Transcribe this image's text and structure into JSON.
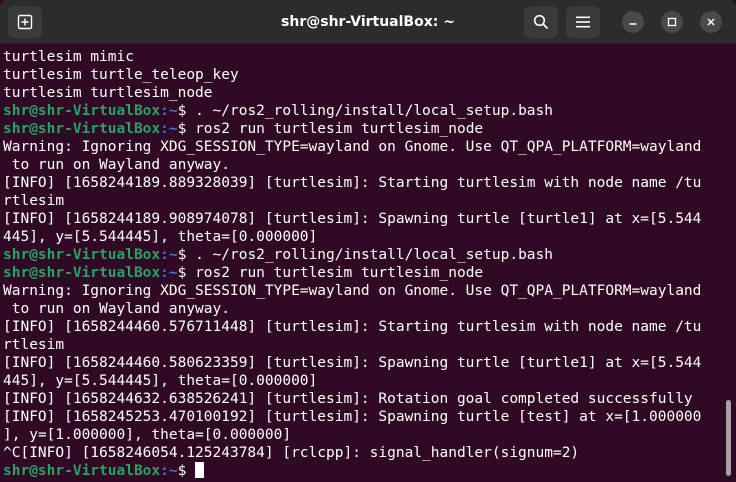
{
  "window": {
    "title": "shr@shr-VirtualBox: ~",
    "colors": {
      "background": "#300a24",
      "titlebar": "#2c2c2c",
      "prompt_user": "#26a269",
      "prompt_path": "#3b78d0",
      "text": "#ffffff"
    }
  },
  "icons": {
    "new_tab": "new-tab-icon",
    "search": "search-icon",
    "menu": "hamburger-menu-icon",
    "minimize": "minimize-icon",
    "maximize": "maximize-icon",
    "close": "close-icon"
  },
  "prompt": {
    "user_host": "shr@shr-VirtualBox",
    "path": ":~",
    "symbol": "$ "
  },
  "lines": [
    {
      "type": "text",
      "text": "turtlesim mimic"
    },
    {
      "type": "text",
      "text": "turtlesim turtle_teleop_key"
    },
    {
      "type": "text",
      "text": "turtlesim turtlesim_node"
    },
    {
      "type": "prompt",
      "cmd": ". ~/ros2_rolling/install/local_setup.bash"
    },
    {
      "type": "prompt",
      "cmd": "ros2 run turtlesim turtlesim_node"
    },
    {
      "type": "text",
      "text": "Warning: Ignoring XDG_SESSION_TYPE=wayland on Gnome. Use QT_QPA_PLATFORM=wayland"
    },
    {
      "type": "text",
      "text": " to run on Wayland anyway."
    },
    {
      "type": "text",
      "text": "[INFO] [1658244189.889328039] [turtlesim]: Starting turtlesim with node name /tu"
    },
    {
      "type": "text",
      "text": "rtlesim"
    },
    {
      "type": "text",
      "text": "[INFO] [1658244189.908974078] [turtlesim]: Spawning turtle [turtle1] at x=[5.544"
    },
    {
      "type": "text",
      "text": "445], y=[5.544445], theta=[0.000000]"
    },
    {
      "type": "prompt",
      "cmd": ". ~/ros2_rolling/install/local_setup.bash"
    },
    {
      "type": "prompt",
      "cmd": "ros2 run turtlesim turtlesim_node"
    },
    {
      "type": "text",
      "text": "Warning: Ignoring XDG_SESSION_TYPE=wayland on Gnome. Use QT_QPA_PLATFORM=wayland"
    },
    {
      "type": "text",
      "text": " to run on Wayland anyway."
    },
    {
      "type": "text",
      "text": "[INFO] [1658244460.576711448] [turtlesim]: Starting turtlesim with node name /tu"
    },
    {
      "type": "text",
      "text": "rtlesim"
    },
    {
      "type": "text",
      "text": "[INFO] [1658244460.580623359] [turtlesim]: Spawning turtle [turtle1] at x=[5.544"
    },
    {
      "type": "text",
      "text": "445], y=[5.544445], theta=[0.000000]"
    },
    {
      "type": "text",
      "text": "[INFO] [1658244632.638526241] [turtlesim]: Rotation goal completed successfully"
    },
    {
      "type": "text",
      "text": "[INFO] [1658245253.470100192] [turtlesim]: Spawning turtle [test] at x=[1.000000"
    },
    {
      "type": "text",
      "text": "], y=[1.000000], theta=[0.000000]"
    },
    {
      "type": "text",
      "text": "^C[INFO] [1658246054.125243784] [rclcpp]: signal_handler(signum=2)"
    },
    {
      "type": "prompt",
      "cmd": "",
      "cursor": true
    }
  ]
}
